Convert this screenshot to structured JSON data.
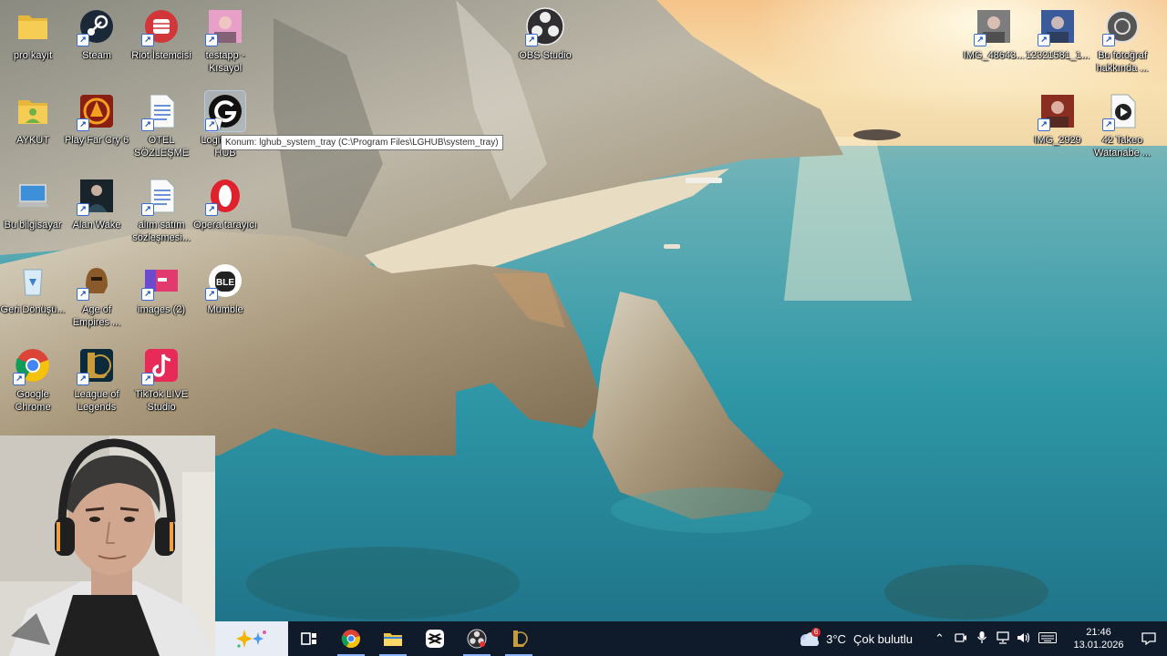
{
  "desktop": {
    "icons_left": [
      {
        "id": "pro-kayit",
        "label": "pro kayıt",
        "color": "#e6c14a",
        "symbol": "folder"
      },
      {
        "id": "steam",
        "label": "Steam",
        "color": "#1b2838",
        "symbol": "steam"
      },
      {
        "id": "riot",
        "label": "Riot İstemcisi",
        "color": "#d13639",
        "symbol": "fist"
      },
      {
        "id": "testapp",
        "label": "testapp - Kısayol",
        "color": "#e8a0c8",
        "symbol": "photo"
      },
      {
        "id": "aykut",
        "label": "AYKUT",
        "color": "#e6c14a",
        "symbol": "user-folder"
      },
      {
        "id": "farcry",
        "label": "Play Far Cry 6",
        "color": "#c8401f",
        "symbol": "fire"
      },
      {
        "id": "otel",
        "label": "OTEL SÖZLEŞME",
        "color": "#f4f4f4",
        "symbol": "document"
      },
      {
        "id": "logi",
        "label": "Logitech G HUB",
        "color": "#111111",
        "symbol": "G"
      },
      {
        "id": "bilgisayar",
        "label": "Bu bilgisayar",
        "color": "#3d8fd8",
        "symbol": "pc"
      },
      {
        "id": "alanwake",
        "label": "Alan Wake",
        "color": "#18232a",
        "symbol": "man"
      },
      {
        "id": "alim",
        "label": "alım satım sözleşmesi...",
        "color": "#f4f4f4",
        "symbol": "document"
      },
      {
        "id": "opera",
        "label": "Opera tarayıcı",
        "color": "#e0202c",
        "symbol": "O"
      },
      {
        "id": "geri",
        "label": "Geri Dönüşü...",
        "color": "#cfe4f2",
        "symbol": "bin"
      },
      {
        "id": "aoe",
        "label": "Age of Empires ...",
        "color": "#8a5a2a",
        "symbol": "helmet"
      },
      {
        "id": "images",
        "label": "images (2)",
        "color": "#e23a6f",
        "symbol": "image"
      },
      {
        "id": "mumble",
        "label": "Mumble",
        "color": "#222222",
        "symbol": "mumble"
      },
      {
        "id": "chrome",
        "label": "Google Chrome",
        "color": "#ffffff",
        "symbol": "chrome"
      },
      {
        "id": "lol",
        "label": "League of Legends",
        "color": "#0b2a3a",
        "symbol": "L"
      },
      {
        "id": "tiktok",
        "label": "TikTok LIVE Studio",
        "color": "#e82a58",
        "symbol": "tiktok"
      }
    ],
    "icons_top": [
      {
        "id": "obs",
        "label": "OBS Studio",
        "color": "#2a2a2a",
        "symbol": "obs"
      }
    ],
    "icons_right": [
      {
        "id": "img486",
        "label": "IMG_48643...",
        "color": "#7d7d7d",
        "symbol": "photo"
      },
      {
        "id": "img123",
        "label": "12321581_1...",
        "color": "#3a5a9a",
        "symbol": "photo"
      },
      {
        "id": "fotograf",
        "label": "Bu fotoğraf hakkında ...",
        "color": "#6a6a6a",
        "symbol": "camera"
      },
      {
        "id": "img2929",
        "label": "IMG_2929",
        "color": "#8a2e22",
        "symbol": "photo"
      },
      {
        "id": "takeo",
        "label": "42 Takeo Watanabe ...",
        "color": "#f4f4f4",
        "symbol": "play"
      }
    ],
    "tooltip": "Konum: lghub_system_tray (C:\\Program Files\\LGHUB\\system_tray)"
  },
  "taskbar": {
    "apps": [
      {
        "id": "taskview",
        "icon": "task-view-icon"
      },
      {
        "id": "chrome",
        "icon": "chrome-icon"
      },
      {
        "id": "explorer",
        "icon": "folder-icon"
      },
      {
        "id": "capcut",
        "icon": "capcut-icon"
      },
      {
        "id": "obs",
        "icon": "obs-icon"
      },
      {
        "id": "lol",
        "icon": "league-icon"
      }
    ],
    "weather": {
      "badge": "6",
      "temp": "3°C",
      "condition": "Çok bulutlu"
    },
    "clock": {
      "time": "21:46",
      "date": "13.01.2026"
    }
  }
}
